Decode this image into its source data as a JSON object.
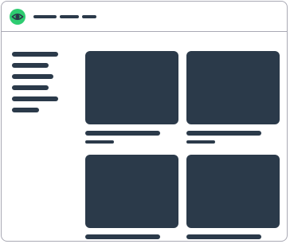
{
  "colors": {
    "window_border": "#a9a9b4",
    "placeholder": "#2b3a4a",
    "brand": "#2ecc71",
    "brand_dark": "#2b3a4a",
    "background": "#ffffff"
  },
  "header": {
    "logo_icon": "eye-icon",
    "nav_items": [
      {
        "name": "nav-item-1"
      },
      {
        "name": "nav-item-2"
      },
      {
        "name": "nav-item-3"
      }
    ]
  },
  "sidebar": {
    "items": [
      {
        "name": "sidebar-item-1"
      },
      {
        "name": "sidebar-item-2"
      },
      {
        "name": "sidebar-item-3"
      },
      {
        "name": "sidebar-item-4"
      },
      {
        "name": "sidebar-item-5"
      },
      {
        "name": "sidebar-item-6"
      }
    ]
  },
  "gallery": {
    "cards": [
      {
        "name": "card-1"
      },
      {
        "name": "card-2"
      },
      {
        "name": "card-3"
      },
      {
        "name": "card-4"
      }
    ]
  }
}
